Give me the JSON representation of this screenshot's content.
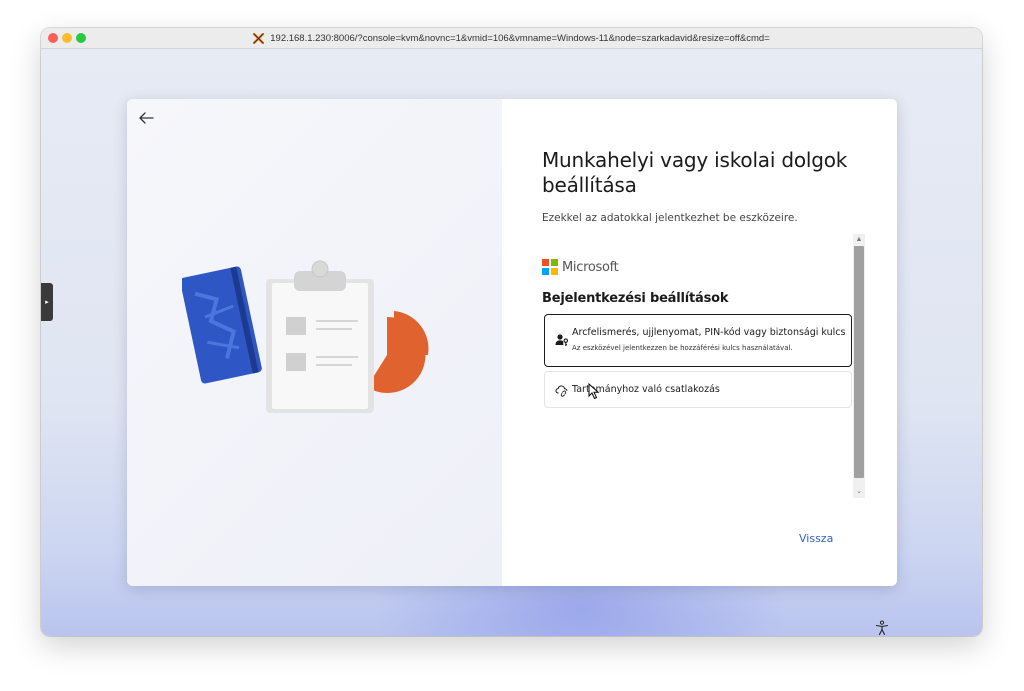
{
  "browser": {
    "url": "192.168.1.230:8006/?console=kvm&novnc=1&vmid=106&vmname=Windows-11&node=szarkadavid&resize=off&cmd="
  },
  "dialog": {
    "heading": "Munkahelyi vagy iskolai dolgok beállítása",
    "subtitle": "Ezekkel az adatokkal jelentkezhet be eszközeire.",
    "brand": "Microsoft",
    "section_title": "Bejelentkezési beállítások",
    "options": [
      {
        "title": "Arcfelismerés, ujjlenyomat, PIN-kód vagy biztonsági kulcs",
        "description": "Az eszközével jelentkezzen be hozzáférési kulcs használatával.",
        "icon": "person-key-icon",
        "selected": true
      },
      {
        "title": "Tartományhoz való csatlakozás",
        "icon": "cloud-link-icon",
        "selected": false
      }
    ],
    "back_button": "Vissza"
  },
  "colors": {
    "accent": "#2f63c8",
    "ms_red": "#f25022",
    "ms_green": "#7fba00",
    "ms_blue": "#00a4ef",
    "ms_yellow": "#ffb900",
    "notebook": "#2e56c4",
    "pie": "#e0622f"
  }
}
